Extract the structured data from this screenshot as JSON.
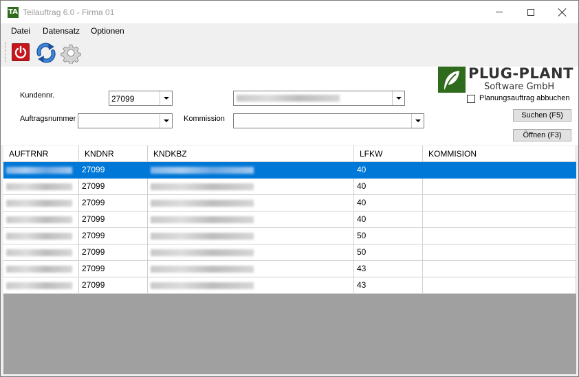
{
  "window": {
    "title": "Teilauftrag 6.0 - Firma 01",
    "app_icon": "TA",
    "accent": "#0078d7"
  },
  "menu": [
    "Datei",
    "Datensatz",
    "Optionen"
  ],
  "toolbar": {
    "icons": [
      "power-icon",
      "refresh-icon",
      "gear-icon"
    ]
  },
  "filters": {
    "kundennr_label": "Kundennr.",
    "kundennr_value": "27099",
    "auftragsnummer_label": "Auftragsnummer",
    "auftragsnummer_value": "",
    "kommission_label": "Kommission",
    "kommission_value": ""
  },
  "logo": {
    "line1": "PLUG-PLANT",
    "line2": "Software GmbH"
  },
  "checkbox": {
    "label": "Planungsauftrag abbuchen",
    "checked": false
  },
  "buttons": {
    "search": "Suchen (F5)",
    "open": "Öffnen (F3)"
  },
  "table": {
    "columns": [
      "AUFTRNR",
      "KNDNR",
      "KNDKBZ",
      "LFKW",
      "KOMMISION"
    ],
    "rows": [
      {
        "kndnr": "27099",
        "lfkw": "40",
        "kommision": ""
      },
      {
        "kndnr": "27099",
        "lfkw": "40",
        "kommision": ""
      },
      {
        "kndnr": "27099",
        "lfkw": "40",
        "kommision": ""
      },
      {
        "kndnr": "27099",
        "lfkw": "40",
        "kommision": ""
      },
      {
        "kndnr": "27099",
        "lfkw": "50",
        "kommision": ""
      },
      {
        "kndnr": "27099",
        "lfkw": "50",
        "kommision": ""
      },
      {
        "kndnr": "27099",
        "lfkw": "43",
        "kommision": ""
      },
      {
        "kndnr": "27099",
        "lfkw": "43",
        "kommision": ""
      }
    ],
    "selected_row": 0
  }
}
